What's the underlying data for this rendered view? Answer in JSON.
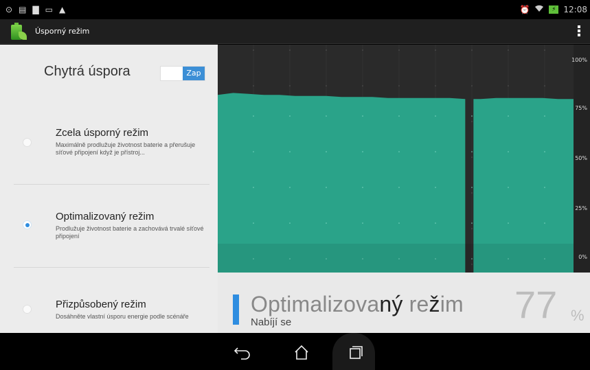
{
  "status_bar": {
    "time": "12:08",
    "left_icons": [
      "sync-icon",
      "signal-icon",
      "document-icon",
      "gallery-icon",
      "warning-icon"
    ],
    "right_icons": [
      "alarm-icon",
      "wifi-icon",
      "battery-charging-icon"
    ]
  },
  "action_bar": {
    "title": "Úsporný režim"
  },
  "smart_saving": {
    "label": "Chytrá úspora",
    "toggle_label": "Zap",
    "toggle_on": true
  },
  "modes": [
    {
      "title": "Zcela úsporný režim",
      "desc": "Maximálně prodlužuje životnost baterie a přerušuje síťové připojení když je přístroj...",
      "selected": false
    },
    {
      "title": "Optimalizovaný režim",
      "desc": "Prodlužuje životnost baterie a zachovává trvalé síťové připojení",
      "selected": true
    },
    {
      "title": "Přizpůsobený režim",
      "desc": "Dosáhněte vlastní úsporu energie podle scénáře",
      "selected": false
    }
  ],
  "chart_data": {
    "type": "area",
    "y_ticks": [
      "100%",
      "75%",
      "50%",
      "25%",
      "0%"
    ],
    "ylim": [
      0,
      100
    ],
    "series": [
      {
        "values": [
          82,
          83,
          82.5,
          82,
          82,
          81.5,
          81.5,
          81.5,
          81,
          81,
          81,
          80.5,
          80.5,
          80.5,
          80.5,
          80.5,
          80,
          80,
          80.5,
          80.5,
          80.5,
          80.5,
          80,
          80
        ]
      }
    ],
    "gap_index": 16,
    "colors": {
      "fill": "#2aa389",
      "background": "#2a2a2a"
    }
  },
  "current_mode": {
    "name_light": "Optimalizova",
    "name_bold_1": "ný",
    "name_mid": " re",
    "name_bold_2": "ž",
    "name_end": "im",
    "status": "Nabíjí se",
    "battery_percent": "77",
    "percent_sign": "%"
  },
  "nav_bar": {
    "buttons": [
      "back-icon",
      "home-icon",
      "recent-apps-icon"
    ]
  },
  "colors": {
    "accent": "#2e8de0",
    "chart_fill": "#2aa389"
  }
}
